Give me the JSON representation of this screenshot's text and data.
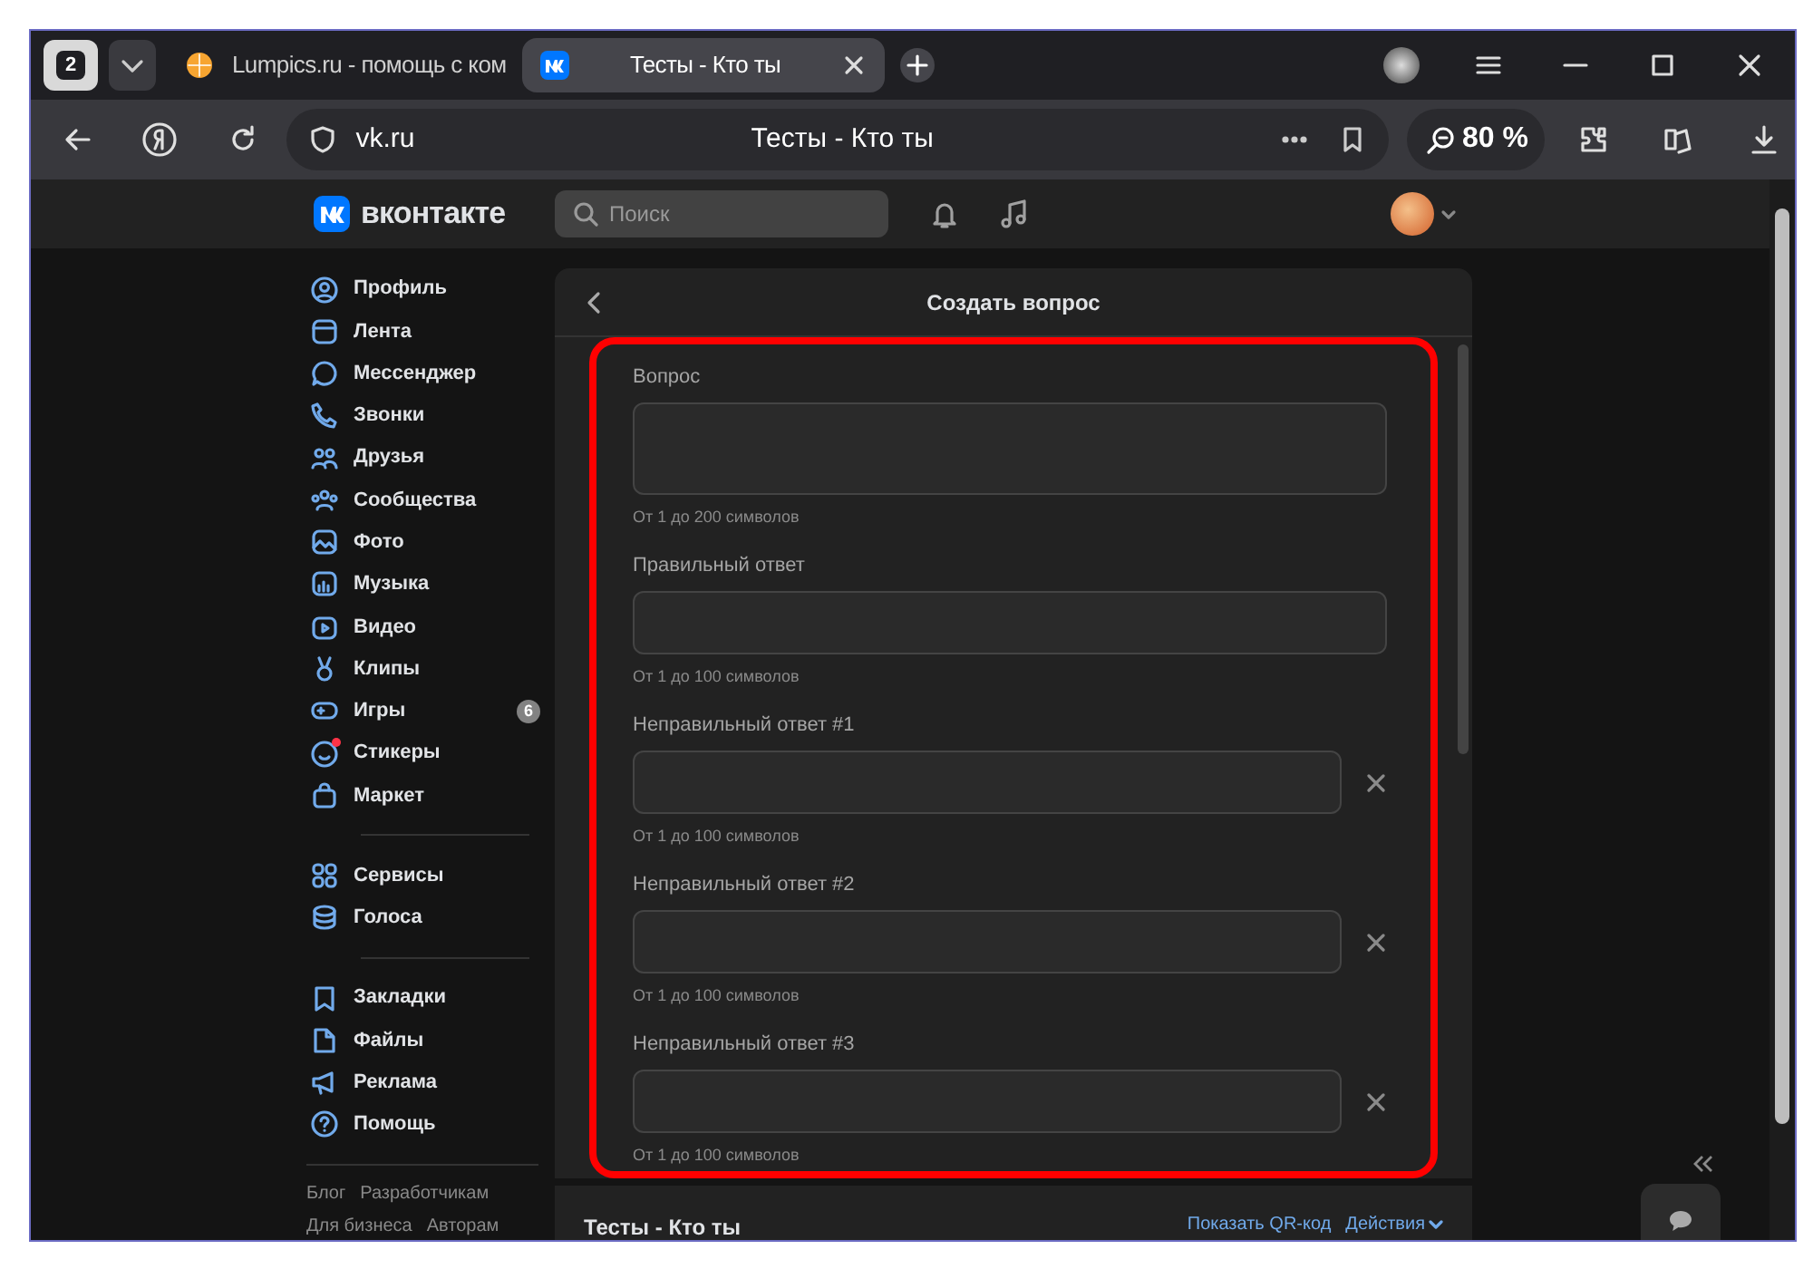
{
  "browser": {
    "tab_count": "2",
    "tabs": [
      {
        "title": "Lumpics.ru - помощь с ком",
        "selected": false
      },
      {
        "title": "Тесты - Кто ты",
        "selected": true
      }
    ],
    "address": "vk.ru",
    "page_title": "Тесты - Кто ты",
    "zoom": "80 %"
  },
  "vk_header": {
    "logo": "вконтакте",
    "search_placeholder": "Поиск"
  },
  "sidebar": {
    "groups": [
      [
        {
          "label": "Профиль"
        },
        {
          "label": "Лента"
        },
        {
          "label": "Мессенджер"
        },
        {
          "label": "Звонки"
        },
        {
          "label": "Друзья"
        },
        {
          "label": "Сообщества"
        },
        {
          "label": "Фото"
        },
        {
          "label": "Музыка"
        },
        {
          "label": "Видео"
        },
        {
          "label": "Клипы"
        },
        {
          "label": "Игры",
          "badge": "6"
        },
        {
          "label": "Стикеры",
          "notification": true
        },
        {
          "label": "Маркет"
        }
      ],
      [
        {
          "label": "Сервисы"
        },
        {
          "label": "Голоса"
        }
      ],
      [
        {
          "label": "Закладки"
        },
        {
          "label": "Файлы"
        },
        {
          "label": "Реклама"
        },
        {
          "label": "Помощь"
        }
      ]
    ],
    "footer_links": [
      "Блог",
      "Разработчикам",
      "Для бизнеса",
      "Авторам"
    ]
  },
  "form": {
    "title": "Создать вопрос",
    "fields": [
      {
        "kind": "question",
        "label": "Вопрос",
        "hint": "От 1 до 200 символов"
      },
      {
        "kind": "answer",
        "label": "Правильный ответ",
        "hint": "От 1 до 100 символов"
      },
      {
        "kind": "removable",
        "label": "Неправильный ответ #1",
        "hint": "От 1 до 100 символов"
      },
      {
        "kind": "removable",
        "label": "Неправильный ответ #2",
        "hint": "От 1 до 100 символов"
      },
      {
        "kind": "removable",
        "label": "Неправильный ответ #3",
        "hint": "От 1 до 100 символов"
      }
    ]
  },
  "app_card": {
    "title": "Тесты - Кто ты",
    "links": [
      "Показать QR-код",
      "Действия"
    ]
  }
}
